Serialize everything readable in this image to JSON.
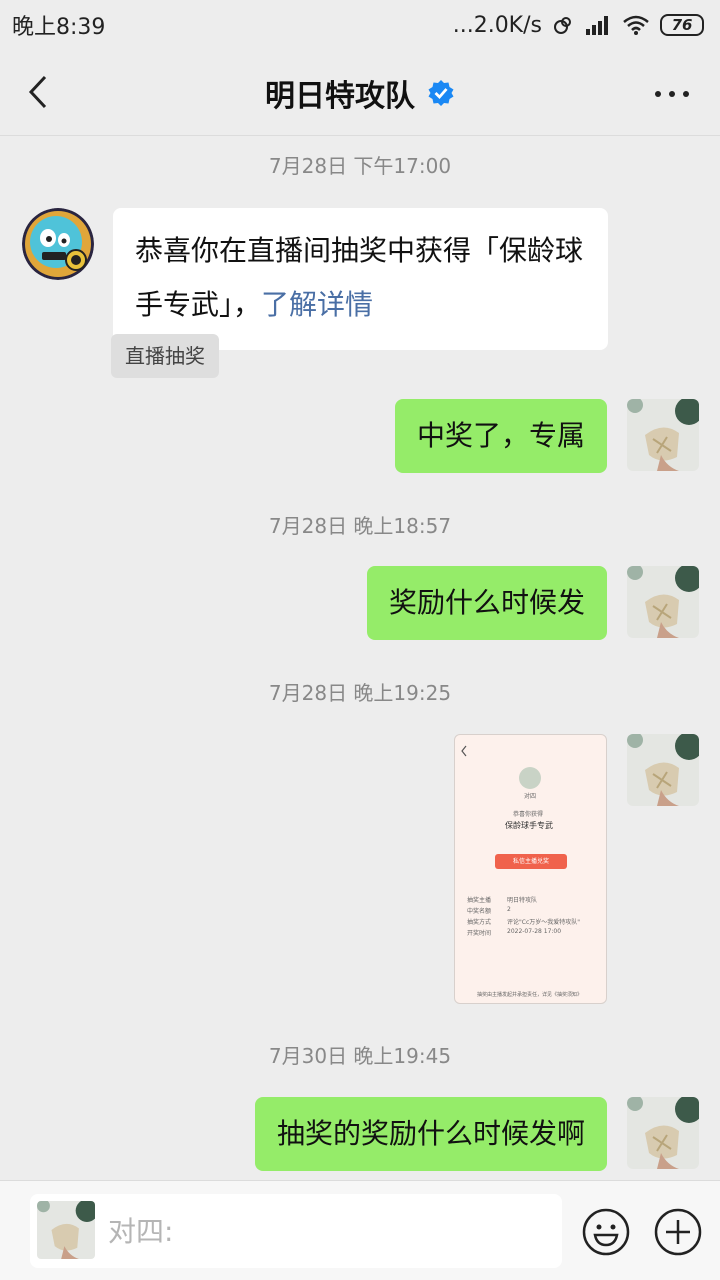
{
  "status_bar": {
    "time": "晚上8:39",
    "network_speed": "...2.0K/s",
    "battery": "76"
  },
  "header": {
    "title": "明日特攻队",
    "verified_icon": "verified-badge-icon",
    "back_icon": "chevron-left-icon",
    "more_icon": "more-dots-icon"
  },
  "messages": {
    "ts1": "7月28日 下午17:00",
    "official_text": "恭喜你在直播间抽奖中获得「保龄球手专武」，",
    "official_link": "了解详情",
    "official_tag": "直播抽奖",
    "reply1": "中奖了，专属",
    "ts2": "7月28日 晚上18:57",
    "reply2": "奖励什么时候发",
    "ts3": "7月28日 晚上19:25",
    "ts4": "7月30日 晚上19:45",
    "reply3": "抽奖的奖励什么时候发啊"
  },
  "screenshot_msg": {
    "username": "对四",
    "congrats": "恭喜你获得",
    "prize": "保龄球手专武",
    "button": "私信主播兑奖",
    "rows": [
      {
        "label": "抽奖主播",
        "value": "明日特攻队"
      },
      {
        "label": "中奖名额",
        "value": "2"
      },
      {
        "label": "抽奖方式",
        "value": "评论\"Cc万岁～我爱特攻队\""
      },
      {
        "label": "开奖时间",
        "value": "2022-07-28 17:00"
      }
    ],
    "footer": "抽奖由主播发起并承担责任，详见《抽奖须知》"
  },
  "input_bar": {
    "placeholder": "对四:",
    "emoji_icon": "emoji-icon",
    "plus_icon": "plus-circle-icon"
  },
  "colors": {
    "self_bubble": "#95ec69",
    "link": "#4a6fa5",
    "verified": "#1a88f4"
  }
}
